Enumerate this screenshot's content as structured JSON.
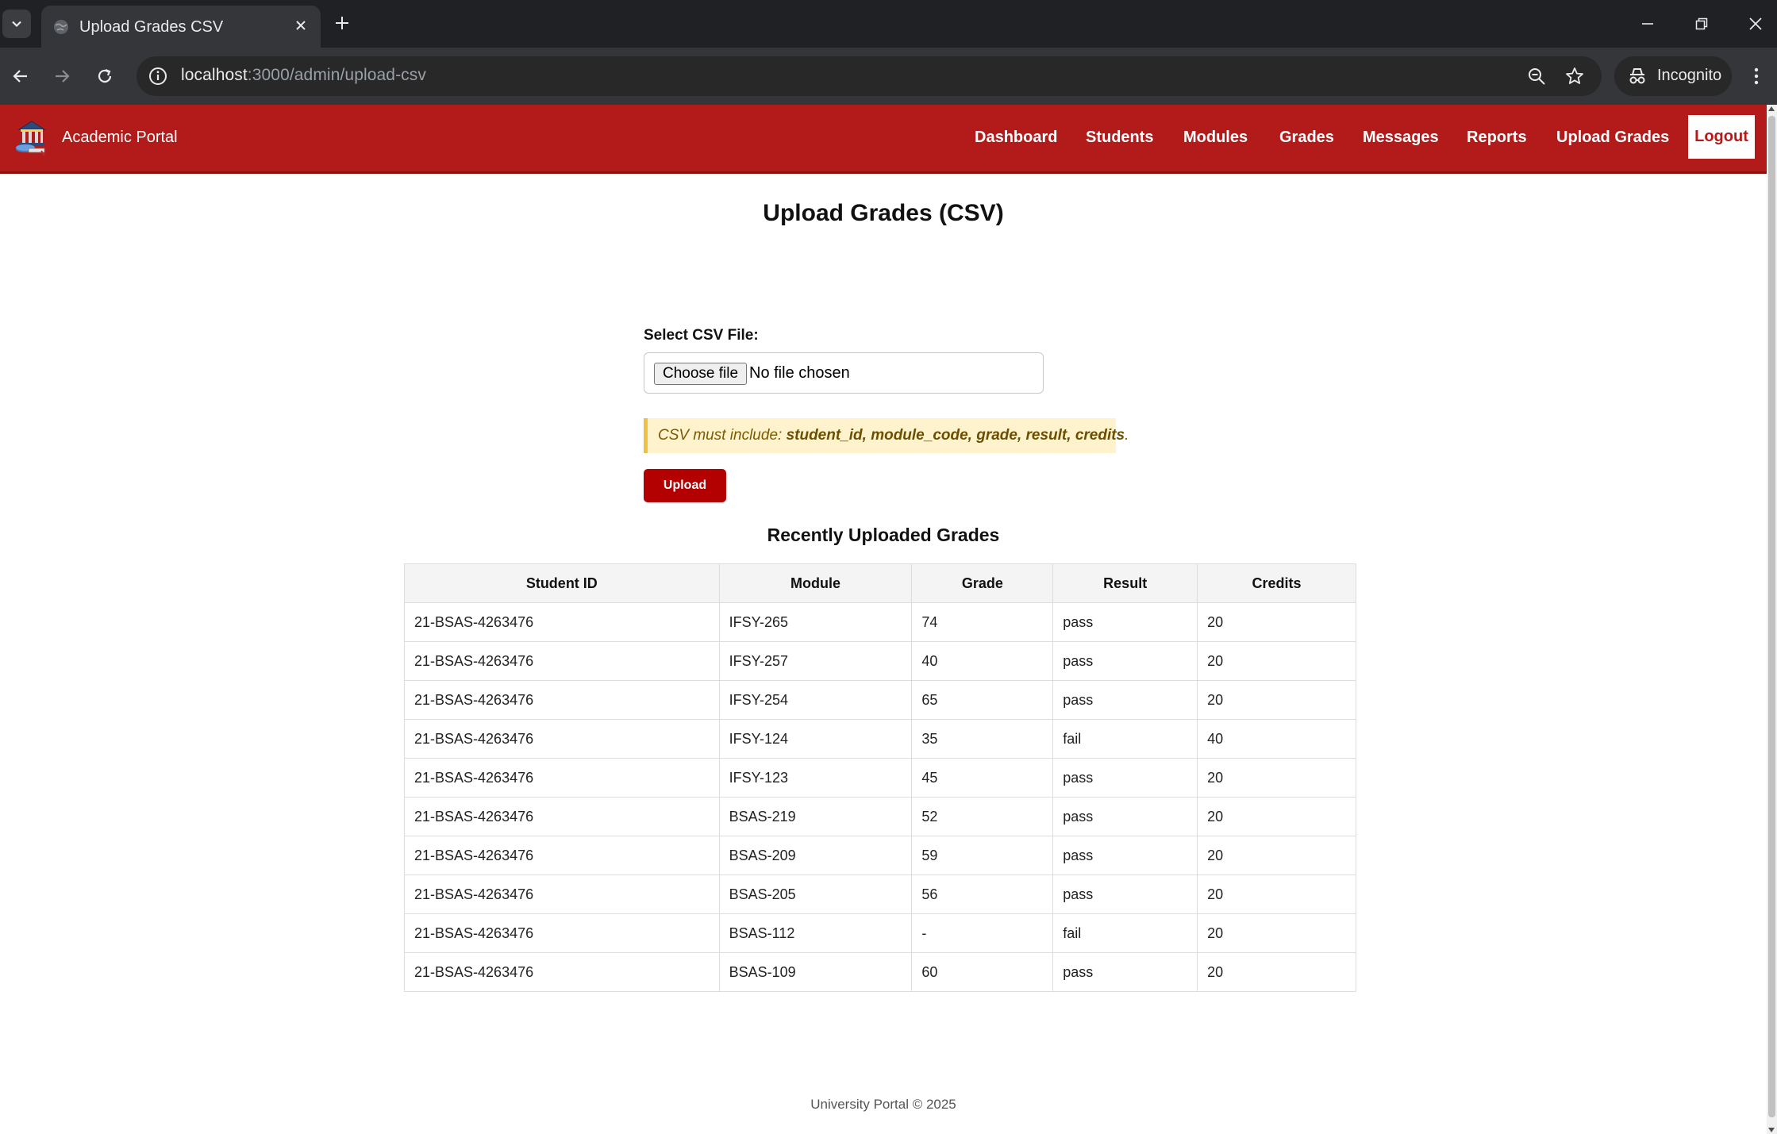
{
  "browser": {
    "tab_title": "Upload Grades CSV",
    "url_host": "localhost",
    "url_path": ":3000/admin/upload-csv",
    "incognito_label": "Incognito"
  },
  "site": {
    "brand": "Academic Portal",
    "nav": {
      "dashboard": "Dashboard",
      "students": "Students",
      "modules": "Modules",
      "grades": "Grades",
      "messages": "Messages",
      "reports": "Reports",
      "upload_grades": "Upload Grades",
      "logout": "Logout"
    },
    "accent_color": "#b31b1b"
  },
  "page": {
    "title": "Upload Grades (CSV)",
    "file_label": "Select CSV File:",
    "file_button": "Choose file",
    "file_status": "No file chosen",
    "notice_prefix": "CSV must include: ",
    "notice_fields": "student_id, module_code, grade, result, credits",
    "notice_suffix": ".",
    "upload_button": "Upload",
    "recent_title": "Recently Uploaded Grades"
  },
  "table": {
    "headers": {
      "student_id": "Student ID",
      "module": "Module",
      "grade": "Grade",
      "result": "Result",
      "credits": "Credits"
    },
    "rows": [
      {
        "student_id": "21-BSAS-4263476",
        "module": "IFSY-265",
        "grade": "74",
        "result": "pass",
        "credits": "20"
      },
      {
        "student_id": "21-BSAS-4263476",
        "module": "IFSY-257",
        "grade": "40",
        "result": "pass",
        "credits": "20"
      },
      {
        "student_id": "21-BSAS-4263476",
        "module": "IFSY-254",
        "grade": "65",
        "result": "pass",
        "credits": "20"
      },
      {
        "student_id": "21-BSAS-4263476",
        "module": "IFSY-124",
        "grade": "35",
        "result": "fail",
        "credits": "40"
      },
      {
        "student_id": "21-BSAS-4263476",
        "module": "IFSY-123",
        "grade": "45",
        "result": "pass",
        "credits": "20"
      },
      {
        "student_id": "21-BSAS-4263476",
        "module": "BSAS-219",
        "grade": "52",
        "result": "pass",
        "credits": "20"
      },
      {
        "student_id": "21-BSAS-4263476",
        "module": "BSAS-209",
        "grade": "59",
        "result": "pass",
        "credits": "20"
      },
      {
        "student_id": "21-BSAS-4263476",
        "module": "BSAS-205",
        "grade": "56",
        "result": "pass",
        "credits": "20"
      },
      {
        "student_id": "21-BSAS-4263476",
        "module": "BSAS-112",
        "grade": "-",
        "result": "fail",
        "credits": "20"
      },
      {
        "student_id": "21-BSAS-4263476",
        "module": "BSAS-109",
        "grade": "60",
        "result": "pass",
        "credits": "20"
      }
    ]
  },
  "footer": {
    "text": "University Portal © 2025"
  }
}
